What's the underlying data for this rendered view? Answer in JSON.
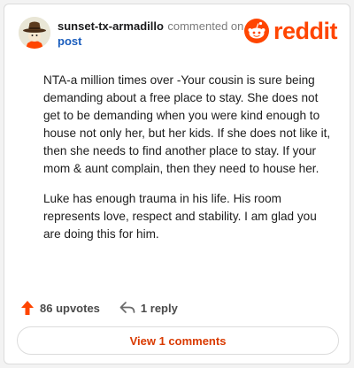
{
  "header": {
    "username": "sunset-tx-armadillo",
    "commented_text": "commented on",
    "post_link": "post",
    "brand": "reddit"
  },
  "comment": {
    "paragraphs": [
      "NTA-a million times over -Your cousin is sure being demanding about a free place to stay. She does not get to be demanding when you were kind enough to house not only her, but her kids. If she does not like it, then she needs to find another place to stay. If your mom & aunt complain, then they need to house her.",
      "Luke has enough trauma in his life. His room represents love, respect and stability. I am glad you are doing this for him."
    ]
  },
  "actions": {
    "upvotes": "86 upvotes",
    "replies": "1 reply"
  },
  "view_comments_label": "View 1 comments",
  "colors": {
    "brand": "#ff4500",
    "link": "#1a5dbd",
    "view_button_text": "#d93a00"
  }
}
